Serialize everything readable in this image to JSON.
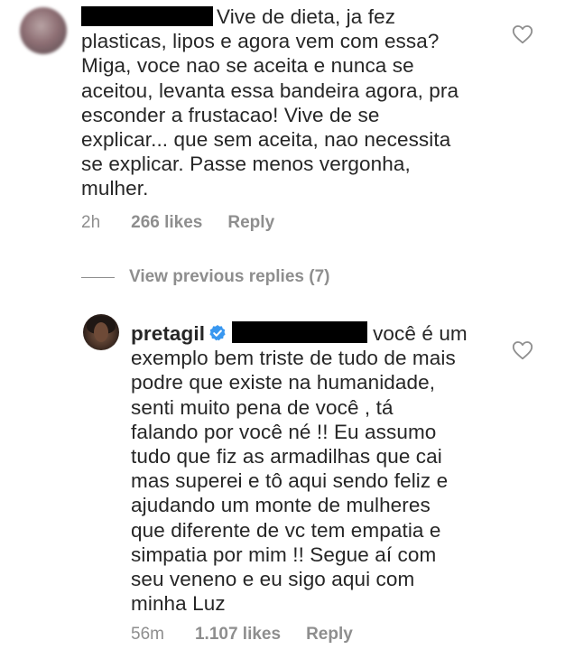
{
  "comments": [
    {
      "username": "",
      "text": "Vive de dieta, ja fez\nplasticas, lipos e agora vem com essa?\nMiga, voce nao se aceita e nunca se\naceitou, levanta essa bandeira agora, pra\nesconder a frustacao! Vive de se\nexplicar... que sem aceita, nao necessita\nse explicar. Passe menos vergonha,\nmulher.",
      "time": "2h",
      "likes": "266 likes",
      "reply": "Reply"
    },
    {
      "username": "pretagil",
      "text_first_line": "você é um",
      "text": "exemplo bem triste de tudo de mais\npodre que existe na humanidade,\nsenti muito pena de você , tá\nfalando por você né !! Eu assumo\ntudo que fiz as armadilhas que cai\nmas superei e tô aqui sendo feliz e\najudando um monte de mulheres\nque diferente de vc tem empatia e\nsimpatia por mim !! Segue aí com\nseu veneno e eu sigo aqui com\nminha Luz",
      "time": "56m",
      "likes": "1.107 likes",
      "reply": "Reply"
    }
  ],
  "view_replies": {
    "label": "View previous replies (7)"
  },
  "icons": {
    "like": "heart-outline-icon",
    "verified": "verified-badge-icon"
  },
  "colors": {
    "text": "#262626",
    "meta": "#8e8e8e",
    "verified": "#3897f0",
    "redaction": "#000000"
  }
}
